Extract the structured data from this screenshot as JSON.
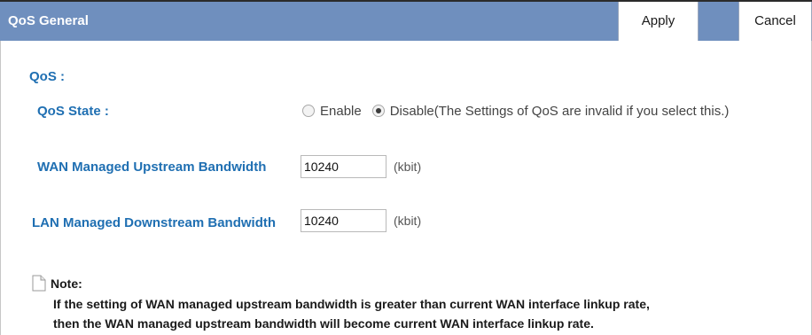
{
  "header": {
    "title": "QoS General",
    "apply_label": "Apply",
    "cancel_label": "Cancel",
    "bar_color": "#6f8fbe"
  },
  "section": {
    "title": "QoS :"
  },
  "qos_state": {
    "label": "QoS State :",
    "options": [
      {
        "label": "Enable",
        "checked": false
      },
      {
        "label": "Disable(The Settings of QoS are invalid if you select this.)",
        "checked": true
      }
    ]
  },
  "wan": {
    "label": "WAN Managed Upstream Bandwidth",
    "value": "10240",
    "unit": "(kbit)"
  },
  "lan": {
    "label": "LAN Managed Downstream Bandwidth",
    "value": "10240",
    "unit": "(kbit)"
  },
  "note": {
    "icon": "document-icon",
    "label": "Note:",
    "lines": [
      "If the setting of WAN managed upstream bandwidth is greater than current WAN interface linkup rate,",
      "then the WAN managed upstream bandwidth will become current WAN interface linkup rate."
    ]
  },
  "colors": {
    "label_blue": "#1f6fb2"
  }
}
